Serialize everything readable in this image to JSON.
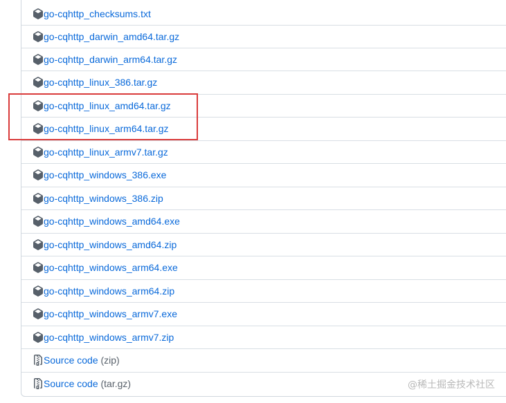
{
  "assets": [
    {
      "name": "go-cqhttp_checksums.txt",
      "icon": "package-icon"
    },
    {
      "name": "go-cqhttp_darwin_amd64.tar.gz",
      "icon": "package-icon"
    },
    {
      "name": "go-cqhttp_darwin_arm64.tar.gz",
      "icon": "package-icon"
    },
    {
      "name": "go-cqhttp_linux_386.tar.gz",
      "icon": "package-icon"
    },
    {
      "name": "go-cqhttp_linux_amd64.tar.gz",
      "icon": "package-icon"
    },
    {
      "name": "go-cqhttp_linux_arm64.tar.gz",
      "icon": "package-icon"
    },
    {
      "name": "go-cqhttp_linux_armv7.tar.gz",
      "icon": "package-icon"
    },
    {
      "name": "go-cqhttp_windows_386.exe",
      "icon": "package-icon"
    },
    {
      "name": "go-cqhttp_windows_386.zip",
      "icon": "package-icon"
    },
    {
      "name": "go-cqhttp_windows_amd64.exe",
      "icon": "package-icon"
    },
    {
      "name": "go-cqhttp_windows_amd64.zip",
      "icon": "package-icon"
    },
    {
      "name": "go-cqhttp_windows_arm64.exe",
      "icon": "package-icon"
    },
    {
      "name": "go-cqhttp_windows_arm64.zip",
      "icon": "package-icon"
    },
    {
      "name": "go-cqhttp_windows_armv7.exe",
      "icon": "package-icon"
    },
    {
      "name": "go-cqhttp_windows_armv7.zip",
      "icon": "package-icon"
    }
  ],
  "source": [
    {
      "name": "Source code",
      "ext": "(zip)",
      "icon": "file-zip-icon"
    },
    {
      "name": "Source code",
      "ext": "(tar.gz)",
      "icon": "file-zip-icon"
    }
  ],
  "watermark": "@稀土掘金技术社区",
  "colors": {
    "link": "#0969da",
    "muted": "#57606a",
    "highlight": "#d93a3a"
  }
}
